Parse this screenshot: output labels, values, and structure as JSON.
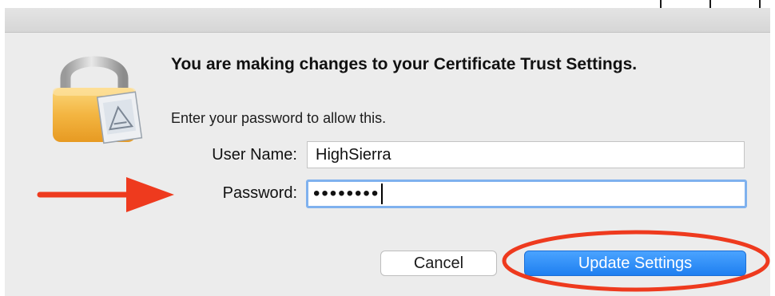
{
  "dialog": {
    "title": "You are making changes to your Certificate Trust Settings.",
    "message": "Enter your password to allow this.",
    "username_label": "User Name:",
    "username_value": "HighSierra",
    "password_label": "Password:",
    "password_masked": "••••••••",
    "cancel_label": "Cancel",
    "update_label": "Update Settings",
    "icon": "lock-icon"
  },
  "colors": {
    "accent_button": "#1f7ff0",
    "focus_ring": "#7fb1ee",
    "annotation": "#ee3a1e"
  }
}
